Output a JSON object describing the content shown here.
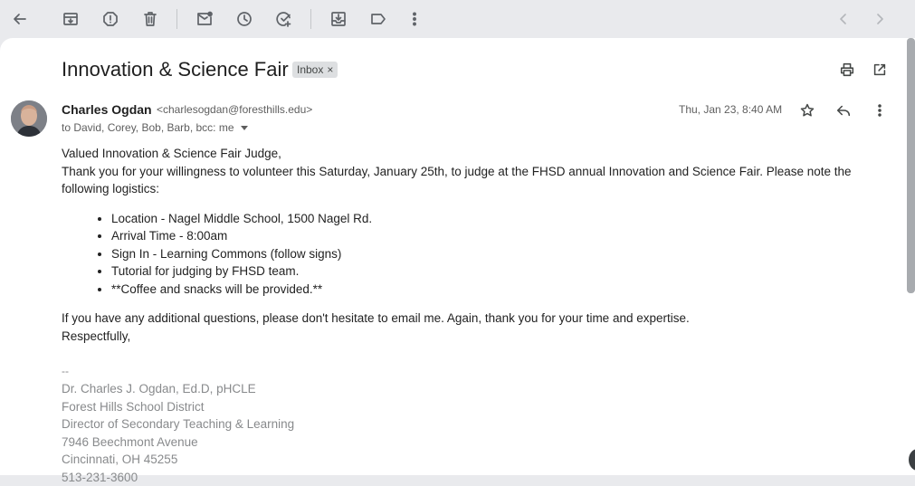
{
  "email": {
    "subject": "Innovation & Science Fair",
    "label_chip": "Inbox",
    "label_chip_remove": "×",
    "sender_name": "Charles Ogdan",
    "sender_email": "<charlesogdan@foresthills.edu>",
    "recipients": "to David, Corey, Bob, Barb, bcc: me",
    "date": "Thu, Jan 23, 8:40 AM",
    "body": {
      "greeting": "Valued Innovation & Science Fair Judge,",
      "intro": "Thank you for your willingness to volunteer this Saturday, January 25th, to judge at the FHSD annual Innovation and Science Fair. Please note the following logistics:",
      "logistics": [
        "Location - Nagel Middle School, 1500 Nagel Rd.",
        "Arrival Time - 8:00am",
        "Sign In - Learning Commons (follow signs)",
        "Tutorial for judging by FHSD team.",
        "**Coffee and snacks will be provided.**"
      ],
      "closing": "If you have any additional questions, please don't hesitate to email me. Again, thank you for your time and expertise.",
      "signoff": "Respectfully,"
    },
    "signature": {
      "separator": "--",
      "name": "Dr. Charles J. Ogdan, Ed.D, pHCLE",
      "org": "Forest Hills School District",
      "title": "Director of Secondary Teaching & Learning",
      "street": "7946 Beechmont Avenue",
      "city": "Cincinnati, OH 45255",
      "phone_partial": "513-231-3600"
    }
  },
  "icons": {
    "toolbar": [
      "back-arrow-icon",
      "archive-icon",
      "report-spam-icon",
      "delete-icon",
      "mark-unread-icon",
      "snooze-icon",
      "add-to-tasks-icon",
      "move-to-icon",
      "label-icon",
      "more-vert-icon",
      "newer-chevron-icon",
      "older-chevron-icon"
    ],
    "header": [
      "print-icon",
      "open-new-window-icon"
    ],
    "message": [
      "star-icon",
      "reply-icon",
      "more-vert-icon"
    ]
  },
  "colors": {
    "chrome_bg": "#e9eaed",
    "sheet_bg": "#ffffff",
    "signature_text": "#888a8c"
  }
}
